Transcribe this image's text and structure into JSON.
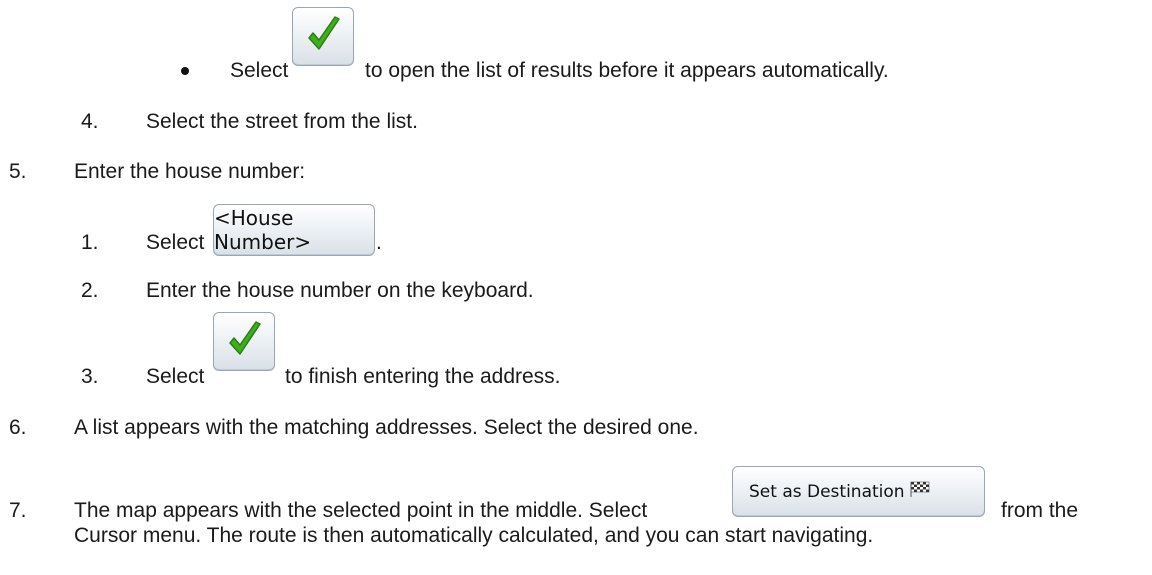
{
  "steps": {
    "bullet_step": {
      "prefix": "Select",
      "suffix": "to open the list of results before it appears automatically.",
      "icon": "checkmark-icon"
    },
    "step4": {
      "number": "4.",
      "text": "Select the street from the list."
    },
    "step5": {
      "number": "5.",
      "text": "Enter the house number:",
      "substeps": [
        {
          "number": "1.",
          "prefix": "Select",
          "button_label": "<House Number>",
          "suffix": "."
        },
        {
          "number": "2.",
          "text": "Enter the house number on the keyboard."
        },
        {
          "number": "3.",
          "prefix": "Select",
          "suffix": "to finish entering the address.",
          "icon": "checkmark-icon"
        }
      ]
    },
    "step6": {
      "number": "6.",
      "text": "A list appears with the matching addresses. Select the desired one."
    },
    "step7": {
      "number": "7.",
      "line1_prefix": "The map appears with the selected point in the middle. Select",
      "button_label": "Set as Destination",
      "button_icon": "checkered-flag-icon",
      "line1_suffix": "from the",
      "line2": "Cursor menu. The route is then automatically calculated, and you can start navigating."
    }
  },
  "colors": {
    "check_green": "#3fae1e",
    "check_dark": "#2a7f10",
    "button_border": "#9aa6b3"
  }
}
